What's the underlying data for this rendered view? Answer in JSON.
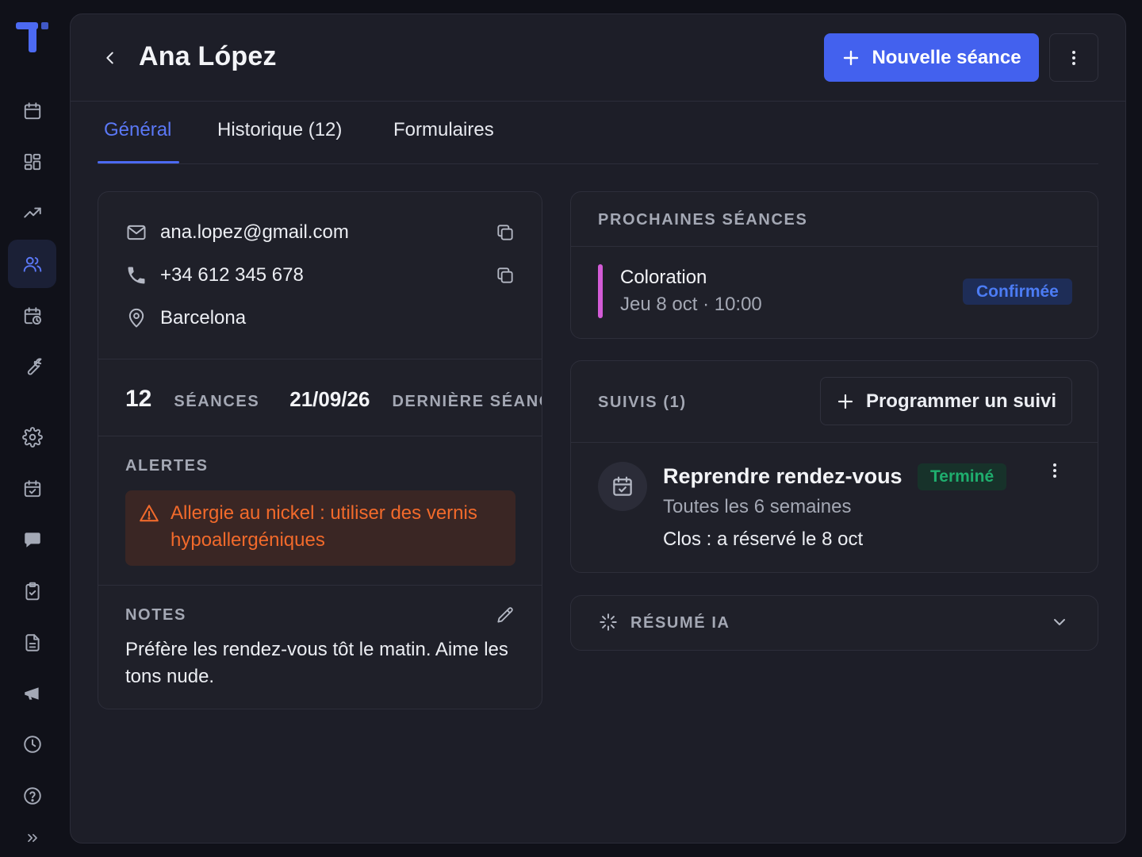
{
  "colors": {
    "accent": "#4361ee",
    "background": "#101119",
    "surface": "#1d1e28",
    "alert_text": "#f26a2b",
    "confirm_badge": "#4c7cf4",
    "done_badge": "#1fae6e",
    "upcoming_bar": "#d35bd6"
  },
  "sidebar": {
    "items": [
      {
        "icon": "calendar-icon"
      },
      {
        "icon": "dashboard-icon"
      },
      {
        "icon": "trending-up-icon"
      },
      {
        "icon": "users-icon",
        "active": true
      },
      {
        "icon": "calendar-clock-icon"
      },
      {
        "icon": "wrench-icon"
      },
      {
        "icon": "settings-icon"
      },
      {
        "icon": "calendar-check-icon"
      },
      {
        "icon": "chat-icon"
      },
      {
        "icon": "clipboard-check-icon"
      },
      {
        "icon": "document-icon"
      },
      {
        "icon": "megaphone-icon"
      },
      {
        "icon": "clock-icon"
      },
      {
        "icon": "help-icon"
      },
      {
        "icon": "expand-icon"
      }
    ]
  },
  "header": {
    "title": "Ana López",
    "new_session_label": "Nouvelle séance"
  },
  "tabs": [
    {
      "label": "Général",
      "active": true
    },
    {
      "label": "Historique (12)"
    },
    {
      "label": "Formulaires"
    }
  ],
  "contact": {
    "email": "ana.lopez@gmail.com",
    "phone": "+34 612 345 678",
    "city": "Barcelona"
  },
  "stats": {
    "sessions_count": "12",
    "sessions_label": "SÉANCES",
    "last_date": "21/09/26",
    "last_label": "DERNIÈRE SÉANC"
  },
  "alerts": {
    "title": "ALERTES",
    "message": "Allergie au nickel : utiliser des vernis hypoallergéniques"
  },
  "notes": {
    "title": "NOTES",
    "text": "Préfère les rendez-vous tôt le matin. Aime les tons nude."
  },
  "upcoming": {
    "title": "PROCHAINES SÉANCES",
    "items": [
      {
        "service": "Coloration",
        "when": "Jeu 8 oct · 10:00",
        "status": "Confirmée"
      }
    ]
  },
  "followups": {
    "title": "SUIVIS (1)",
    "add_label": "Programmer un suivi",
    "items": [
      {
        "title": "Reprendre rendez-vous",
        "status": "Terminé",
        "frequency": "Toutes les 6 semaines",
        "note": "Clos : a réservé le 8 oct"
      }
    ]
  },
  "ai_summary": {
    "title": "RÉSUMÉ IA"
  }
}
